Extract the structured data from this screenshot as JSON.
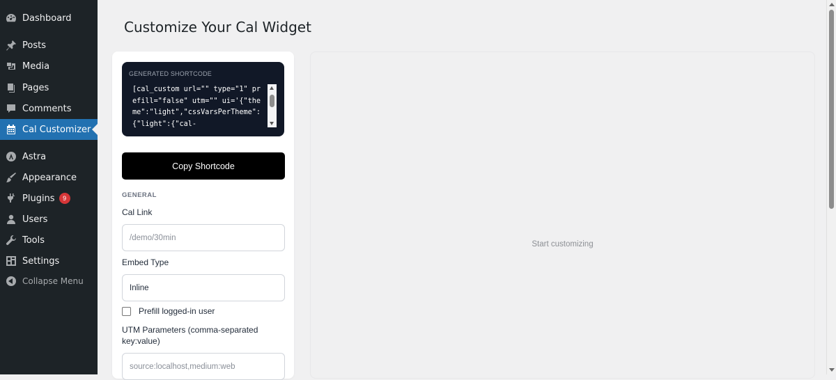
{
  "sidebar": {
    "items": [
      {
        "label": "Dashboard",
        "icon": "dashboard-icon"
      },
      {
        "label": "Posts",
        "icon": "pin-icon"
      },
      {
        "label": "Media",
        "icon": "media-icon"
      },
      {
        "label": "Pages",
        "icon": "pages-icon"
      },
      {
        "label": "Comments",
        "icon": "comment-icon"
      },
      {
        "label": "Cal Customizer",
        "icon": "calendar-icon",
        "active": true
      },
      {
        "label": "Astra",
        "icon": "astra-icon"
      },
      {
        "label": "Appearance",
        "icon": "brush-icon"
      },
      {
        "label": "Plugins",
        "icon": "plugin-icon",
        "badge": "9"
      },
      {
        "label": "Users",
        "icon": "user-icon"
      },
      {
        "label": "Tools",
        "icon": "wrench-icon"
      },
      {
        "label": "Settings",
        "icon": "settings-icon"
      },
      {
        "label": "Collapse Menu",
        "icon": "collapse-icon"
      }
    ]
  },
  "page": {
    "title": "Customize Your Cal Widget"
  },
  "shortcode": {
    "label": "GENERATED SHORTCODE",
    "text": "[cal_custom url=\"\" type=\"1\" prefill=\"false\" utm=\"\" ui='{\"theme\":\"light\",\"cssVarsPerTheme\":{\"light\":{\"cal-"
  },
  "buttons": {
    "copy_label": "Copy Shortcode"
  },
  "general": {
    "section_label": "GENERAL",
    "cal_link_label": "Cal Link",
    "cal_link_placeholder": "/demo/30min",
    "embed_type_label": "Embed Type",
    "embed_type_value": "Inline",
    "prefill_label": "Prefill logged-in user",
    "utm_label": "UTM Parameters (comma-separated key:value)",
    "utm_placeholder": "source:localhost,medium:web"
  },
  "preview": {
    "placeholder": "Start customizing"
  },
  "colors": {
    "sidebar_bg": "#1d2327",
    "active_bg": "#2271b1",
    "badge_bg": "#d63638",
    "shortcode_bg": "#111827"
  }
}
